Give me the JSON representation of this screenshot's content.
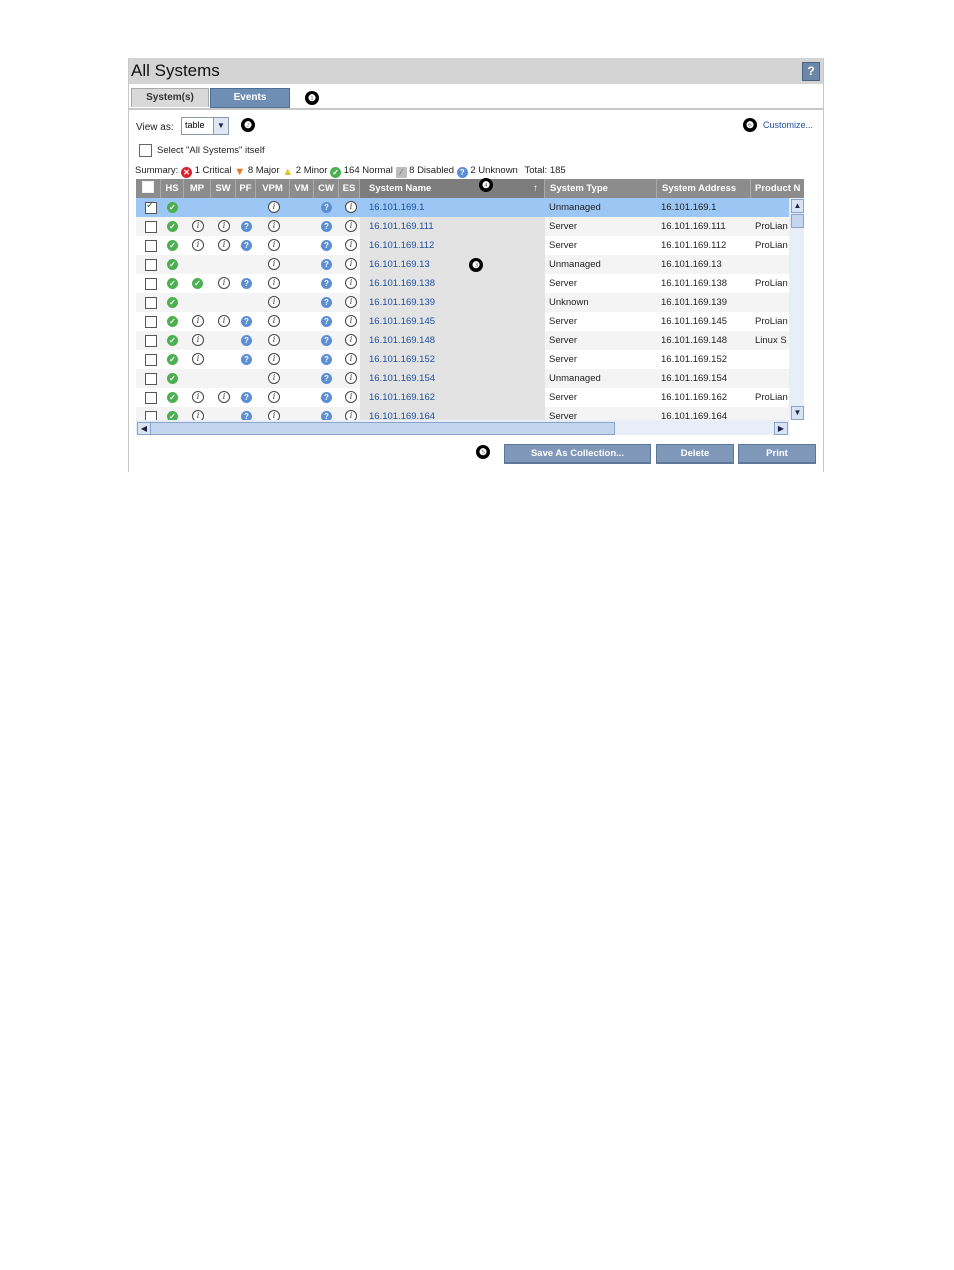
{
  "window": {
    "title": "All Systems",
    "help": "?"
  },
  "tabs": [
    {
      "label": "System(s)"
    },
    {
      "label": "Events"
    }
  ],
  "callouts": [
    "❶",
    "❷",
    "❸",
    "❹",
    "❺",
    "❻"
  ],
  "view_as": {
    "label": "View as:",
    "value": "table"
  },
  "customize": "Customize...",
  "select_all": "Select \"All Systems\" itself",
  "summary": {
    "prefix": "Summary:",
    "critical": "1 Critical",
    "major": "8 Major",
    "minor": "2 Minor",
    "normal": "164 Normal",
    "disabled": "8 Disabled",
    "unknown": "2 Unknown",
    "total": "Total: 185"
  },
  "columns": [
    "HS",
    "MP",
    "SW",
    "PF",
    "VPM",
    "VM",
    "CW",
    "ES",
    "System Name",
    "System Type",
    "System Address",
    "Product N"
  ],
  "sort_indicator": "↑",
  "rows": [
    {
      "name": "16.101.169.1",
      "type": "Unmanaged",
      "address": "16.101.169.1",
      "product": "",
      "hs": "ok",
      "mp": "",
      "sw": "",
      "pf": "",
      "vpm": "i",
      "cw": "?",
      "es": "i",
      "checked": true
    },
    {
      "name": "16.101.169.111",
      "type": "Server",
      "address": "16.101.169.111",
      "product": "ProLian",
      "hs": "ok",
      "mp": "i",
      "sw": "i",
      "pf": "?",
      "vpm": "i",
      "cw": "?",
      "es": "i",
      "checked": false
    },
    {
      "name": "16.101.169.112",
      "type": "Server",
      "address": "16.101.169.112",
      "product": "ProLian",
      "hs": "ok",
      "mp": "i",
      "sw": "i",
      "pf": "?",
      "vpm": "i",
      "cw": "?",
      "es": "i",
      "checked": false
    },
    {
      "name": "16.101.169.13",
      "type": "Unmanaged",
      "address": "16.101.169.13",
      "product": "",
      "hs": "ok",
      "mp": "",
      "sw": "",
      "pf": "",
      "vpm": "i",
      "cw": "?",
      "es": "i",
      "checked": false
    },
    {
      "name": "16.101.169.138",
      "type": "Server",
      "address": "16.101.169.138",
      "product": "ProLian",
      "hs": "ok",
      "mp": "ok",
      "sw": "i",
      "pf": "?",
      "vpm": "i",
      "cw": "?",
      "es": "i",
      "checked": false
    },
    {
      "name": "16.101.169.139",
      "type": "Unknown",
      "address": "16.101.169.139",
      "product": "",
      "hs": "ok",
      "mp": "",
      "sw": "",
      "pf": "",
      "vpm": "i",
      "cw": "?",
      "es": "i",
      "checked": false
    },
    {
      "name": "16.101.169.145",
      "type": "Server",
      "address": "16.101.169.145",
      "product": "ProLian",
      "hs": "ok",
      "mp": "i",
      "sw": "i",
      "pf": "?",
      "vpm": "i",
      "cw": "?",
      "es": "i",
      "checked": false
    },
    {
      "name": "16.101.169.148",
      "type": "Server",
      "address": "16.101.169.148",
      "product": "Linux S",
      "hs": "ok",
      "mp": "i",
      "sw": "",
      "pf": "?",
      "vpm": "i",
      "cw": "?",
      "es": "i",
      "checked": false
    },
    {
      "name": "16.101.169.152",
      "type": "Server",
      "address": "16.101.169.152",
      "product": "",
      "hs": "ok",
      "mp": "i",
      "sw": "",
      "pf": "?",
      "vpm": "i",
      "cw": "?",
      "es": "i",
      "checked": false
    },
    {
      "name": "16.101.169.154",
      "type": "Unmanaged",
      "address": "16.101.169.154",
      "product": "",
      "hs": "ok",
      "mp": "",
      "sw": "",
      "pf": "",
      "vpm": "i",
      "cw": "?",
      "es": "i",
      "checked": false
    },
    {
      "name": "16.101.169.162",
      "type": "Server",
      "address": "16.101.169.162",
      "product": "ProLian",
      "hs": "ok",
      "mp": "i",
      "sw": "i",
      "pf": "?",
      "vpm": "i",
      "cw": "?",
      "es": "i",
      "checked": false
    },
    {
      "name": "16.101.169.164",
      "type": "Server",
      "address": "16.101.169.164",
      "product": "",
      "hs": "ok",
      "mp": "i",
      "sw": "",
      "pf": "?",
      "vpm": "i",
      "cw": "?",
      "es": "i",
      "checked": false
    }
  ],
  "buttons": {
    "save": "Save As Collection...",
    "delete": "Delete",
    "print": "Print"
  },
  "colors": {
    "link": "#1f4fa0",
    "header": "#8c8c8c",
    "selected_row": "#9cc7f4",
    "button": "#7f98ba"
  }
}
